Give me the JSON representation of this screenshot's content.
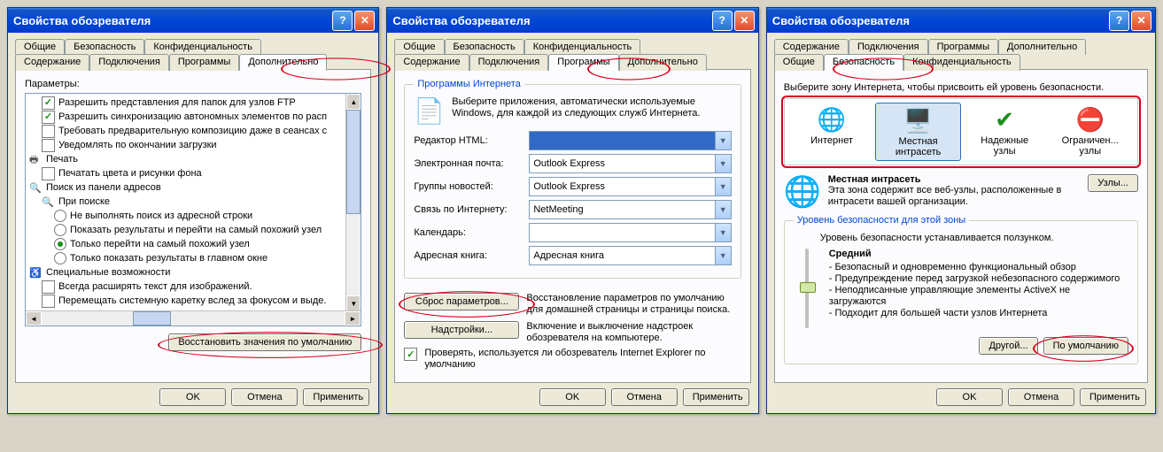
{
  "dialog_title": "Свойства обозревателя",
  "buttons": {
    "ok": "OK",
    "cancel": "Отмена",
    "apply": "Применить"
  },
  "w1": {
    "tabs_row1": [
      "Общие",
      "Безопасность",
      "Конфиденциальность"
    ],
    "tabs_row2": [
      "Содержание",
      "Подключения",
      "Программы",
      "Дополнительно"
    ],
    "active_tab": "Дополнительно",
    "params_label": "Параметры:",
    "restore_btn": "Восстановить значения по умолчанию",
    "tree": {
      "i1": "Разрешить представления для папок для узлов FTP",
      "i2": "Разрешить синхронизацию автономных элементов по расп",
      "i3": "Требовать предварительную композицию даже в сеансах с",
      "i4": "Уведомлять по окончании загрузки",
      "g_print": "Печать",
      "i5": "Печатать цвета и рисунки фона",
      "g_search": "Поиск из панели адресов",
      "g_search2": "При поиске",
      "r1": "Не выполнять поиск из адресной строки",
      "r2": "Показать результаты и перейти на самый похожий узел",
      "r3": "Только перейти на самый похожий узел",
      "r4": "Только показать результаты в главном окне",
      "g_access": "Специальные возможности",
      "i6": "Всегда расширять текст для изображений.",
      "i7": "Перемещать системную каретку вслед за фокусом и выде."
    }
  },
  "w2": {
    "tabs_row1": [
      "Общие",
      "Безопасность",
      "Конфиденциальность"
    ],
    "tabs_row2": [
      "Содержание",
      "Подключения",
      "Программы",
      "Дополнительно"
    ],
    "active_tab": "Программы",
    "group_title": "Программы Интернета",
    "group_desc": "Выберите приложения, автоматически используемые Windows, для каждой из следующих служб Интернета.",
    "rows": {
      "html_label": "Редактор HTML:",
      "html_value": "",
      "mail_label": "Электронная почта:",
      "mail_value": "Outlook Express",
      "news_label": "Группы новостей:",
      "news_value": "Outlook Express",
      "net_label": "Связь по Интернету:",
      "net_value": "NetMeeting",
      "cal_label": "Календарь:",
      "cal_value": "",
      "addr_label": "Адресная книга:",
      "addr_value": "Адресная книга"
    },
    "reset_btn": "Сброс параметров...",
    "reset_desc": "Восстановление параметров по умолчанию для домашней страницы и страницы поиска.",
    "addons_btn": "Надстройки...",
    "addons_desc": "Включение и выключение надстроек обозревателя на компьютере.",
    "check_default": "Проверять, используется ли обозреватель Internet Explorer по умолчанию"
  },
  "w3": {
    "tabs_row1": [
      "Содержание",
      "Подключения",
      "Программы",
      "Дополнительно"
    ],
    "tabs_row2": [
      "Общие",
      "Безопасность",
      "Конфиденциальность"
    ],
    "active_tab": "Безопасность",
    "hint": "Выберите зону Интернета, чтобы присвоить ей уровень безопасности.",
    "zones": {
      "z1": "Интернет",
      "z2a": "Местная",
      "z2b": "интрасеть",
      "z3a": "Надежные",
      "z3b": "узлы",
      "z4a": "Ограничен...",
      "z4b": "узлы"
    },
    "zone_detail": {
      "title": "Местная интрасеть",
      "desc": "Эта зона содержит все веб-узлы, расположенные в интрасети вашей организации.",
      "sites_btn": "Узлы..."
    },
    "level_group": "Уровень безопасности для этой зоны",
    "level_hint": "Уровень безопасности устанавливается ползунком.",
    "level_name": "Средний",
    "bul1": "- Безопасный и одновременно функциональный обзор",
    "bul2": "- Предупреждение перед загрузкой небезопасного содержимого",
    "bul3": "- Неподписанные управляющие элементы ActiveX не загружаются",
    "bul4": "- Подходит для большей части узлов Интернета",
    "custom_btn": "Другой...",
    "default_btn": "По умолчанию"
  }
}
